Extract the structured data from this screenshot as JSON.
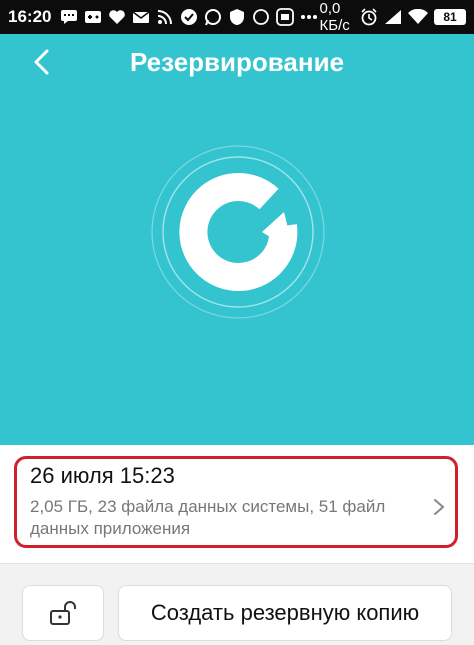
{
  "status_bar": {
    "time": "16:20",
    "network_speed": "0,0 КБ/с",
    "battery": "81",
    "icons": [
      "message-icon",
      "game-icon",
      "heart-icon",
      "mail-icon",
      "rss-icon",
      "check-icon",
      "whatsapp-icon",
      "shield-icon",
      "circle-icon",
      "mail-app-icon",
      "more-icon",
      "alarm-icon",
      "signal-icon",
      "wifi-icon"
    ]
  },
  "header": {
    "title": "Резервирование",
    "back_icon": "back-chevron-icon"
  },
  "colors": {
    "hero_bg": "#33c4d0",
    "highlight": "#d0202c",
    "status_bar_bg": "#0c0c0c"
  },
  "backup": {
    "date": "26 июля 15:23",
    "details": "2,05 ГБ, 23 файла данных системы, 51 файл данных приложения"
  },
  "actions": {
    "lock_icon": "unlock-icon",
    "create_label": "Создать резервную копию"
  }
}
